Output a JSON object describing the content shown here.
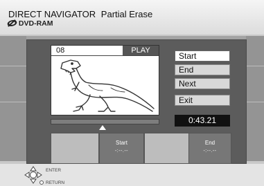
{
  "header": {
    "title": "DIRECT NAVIGATOR",
    "subtitle_action": "Partial Erase",
    "disc_type": "DVD-RAM"
  },
  "preview": {
    "title_number": "08",
    "status": "PLAY"
  },
  "menu": {
    "items": [
      {
        "label": "Start",
        "selected": true
      },
      {
        "label": "End",
        "selected": false
      },
      {
        "label": "Next",
        "selected": false
      },
      {
        "label": "Exit",
        "selected": false
      }
    ]
  },
  "time_display": "0:43.21",
  "start_point": {
    "label": "Start",
    "time": "-:--.--"
  },
  "end_point": {
    "label": "End",
    "time": "-:--.--"
  },
  "footer": {
    "enter_label": "ENTER",
    "return_label": "RETURN"
  },
  "colors": {
    "selected_button": "#ffffff",
    "button": "#d8d8d8",
    "panel": "#5c5c5c",
    "time_display_bg": "#111111"
  }
}
